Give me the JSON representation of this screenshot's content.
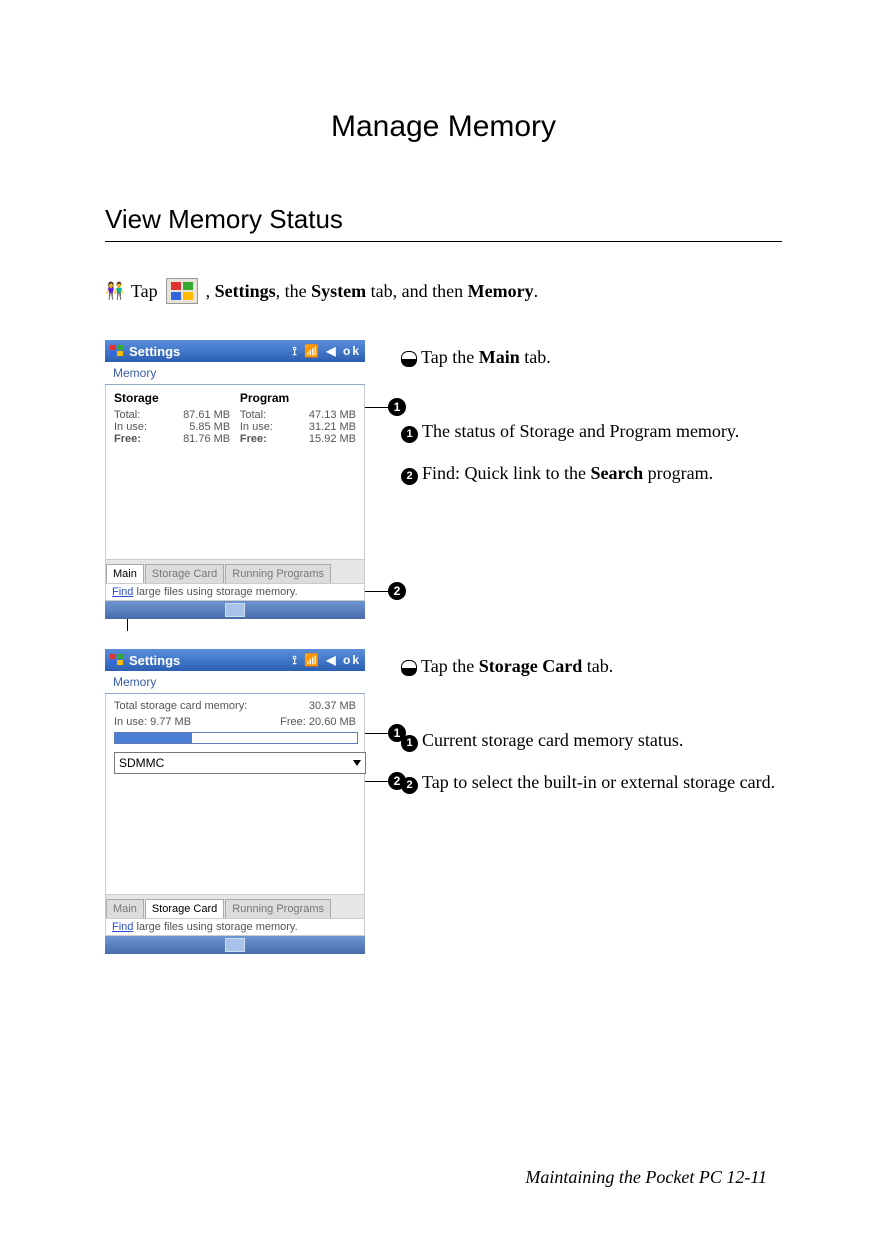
{
  "title": "Manage Memory",
  "section": "View Memory Status",
  "intro": {
    "tap": "Tap",
    "rest": ", Settings, the System tab, and then Memory."
  },
  "shot1": {
    "titlebar": "Settings",
    "subheader": "Memory",
    "storage_head": "Storage",
    "program_head": "Program",
    "labels": {
      "total": "Total:",
      "inuse": "In use:",
      "free": "Free:"
    },
    "storage": {
      "total": "87.61 MB",
      "inuse": "5.85 MB",
      "free": "81.76 MB"
    },
    "program": {
      "total": "47.13 MB",
      "inuse": "31.21 MB",
      "free": "15.92 MB"
    },
    "tabs": {
      "main": "Main",
      "card": "Storage Card",
      "running": "Running Programs"
    },
    "find": {
      "link": "Find",
      "rest": " large files using storage memory."
    }
  },
  "shot2": {
    "titlebar": "Settings",
    "subheader": "Memory",
    "total_card_label": "Total storage card memory:",
    "total_card_val": "30.37 MB",
    "inuse_label": "In use:",
    "inuse_val": "9.77 MB",
    "free_label": "Free:",
    "free_val": "20.60 MB",
    "dropdown": "SDMMC",
    "tabs": {
      "main": "Main",
      "card": "Storage Card",
      "running": "Running Programs"
    },
    "find": {
      "link": "Find",
      "rest": " large files using storage memory."
    }
  },
  "anno1": {
    "c": "Tap the Main tab.",
    "n1": "The status of Storage and Program memory.",
    "n2a": "Find: Quick link to the ",
    "n2b": "Search",
    "n2c": " program."
  },
  "anno2": {
    "c": "Tap the Storage Card tab.",
    "n1": "Current storage card memory status.",
    "n2": "Tap to select the built-in or external storage card."
  },
  "markers": {
    "m1": "1",
    "m2": "2"
  },
  "footer": "Maintaining the Pocket PC    12-11"
}
